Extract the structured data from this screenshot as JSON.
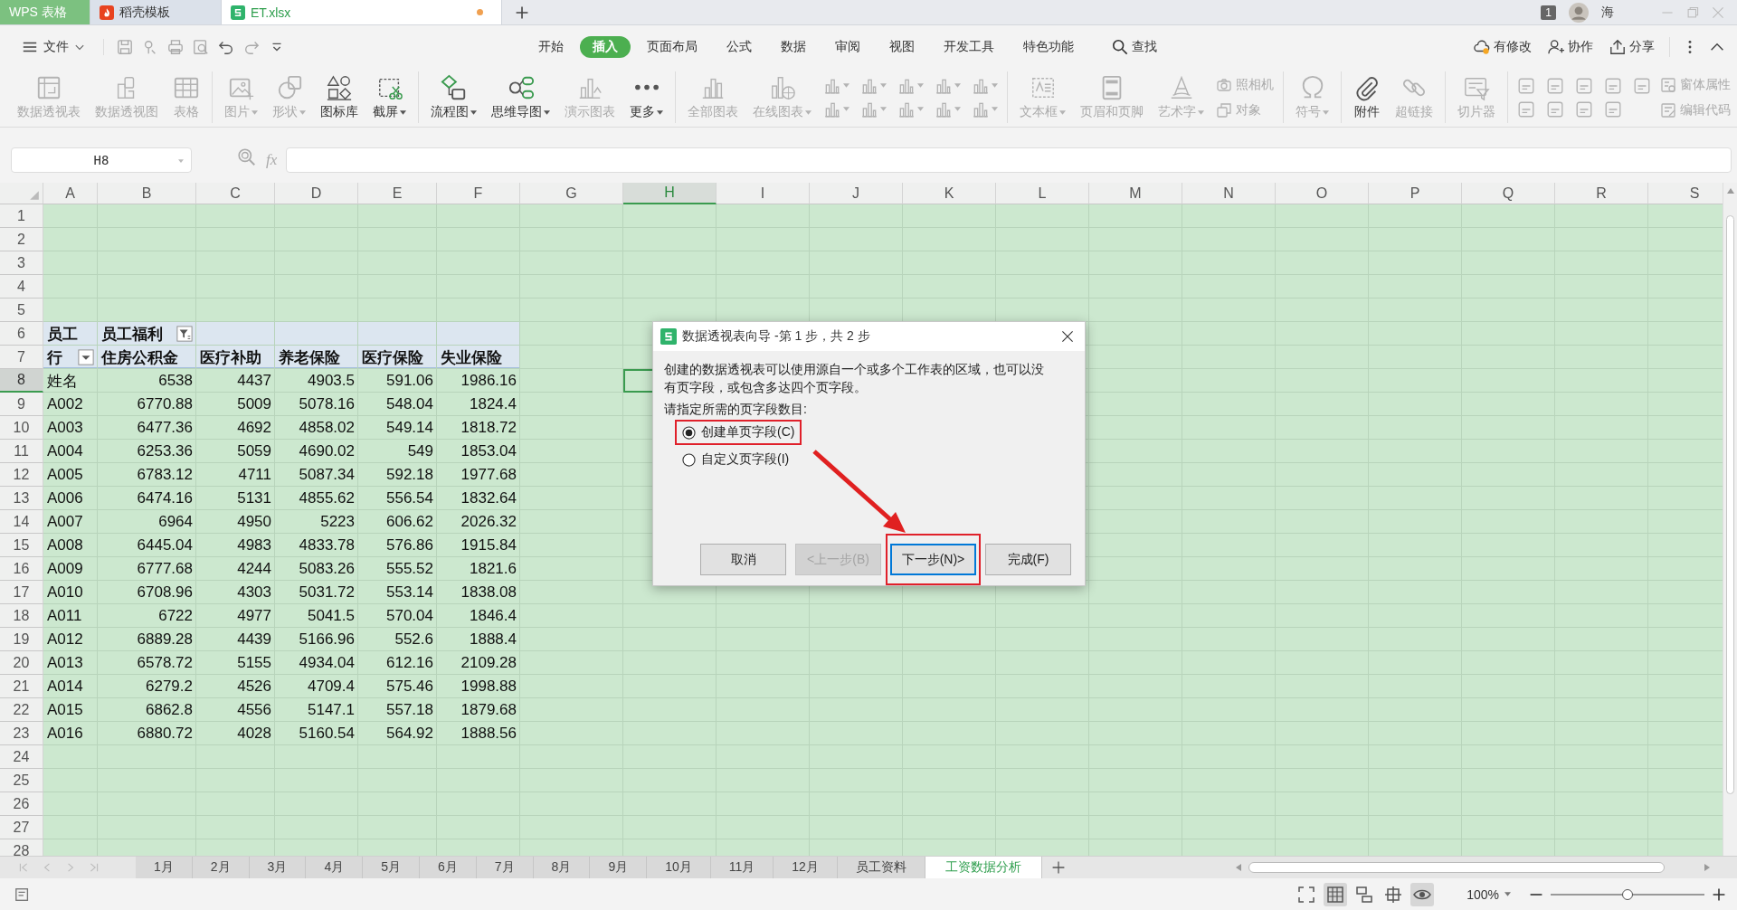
{
  "title_bar": {
    "tabs": [
      {
        "kind": "app",
        "label": "WPS 表格",
        "selected": false,
        "modified": false
      },
      {
        "kind": "template",
        "label": "稻壳模板",
        "selected": false,
        "modified": false
      },
      {
        "kind": "document",
        "label": "ET.xlsx",
        "selected": true,
        "modified": true
      }
    ],
    "badge": "1",
    "user": "海"
  },
  "menu_bar": {
    "file": "文件",
    "tabs": [
      {
        "label": "开始",
        "selected": false
      },
      {
        "label": "插入",
        "selected": true
      },
      {
        "label": "页面布局",
        "selected": false
      },
      {
        "label": "公式",
        "selected": false
      },
      {
        "label": "数据",
        "selected": false
      },
      {
        "label": "审阅",
        "selected": false
      },
      {
        "label": "视图",
        "selected": false
      },
      {
        "label": "开发工具",
        "selected": false
      },
      {
        "label": "特色功能",
        "selected": false
      }
    ],
    "search": "查找",
    "actions": [
      "有修改",
      "协作",
      "分享"
    ]
  },
  "ribbon": [
    {
      "items": [
        {
          "kind": "large",
          "label": "数据透视表",
          "disabled": true,
          "dropdown": false
        },
        {
          "kind": "large",
          "label": "数据透视图",
          "disabled": true,
          "dropdown": false
        },
        {
          "kind": "large",
          "label": "表格",
          "disabled": true,
          "dropdown": false
        }
      ]
    },
    {
      "items": [
        {
          "kind": "large",
          "label": "图片",
          "disabled": true,
          "dropdown": true
        },
        {
          "kind": "large",
          "label": "形状",
          "disabled": true,
          "dropdown": true
        },
        {
          "kind": "large",
          "label": "图标库",
          "disabled": false,
          "dropdown": false
        },
        {
          "kind": "large",
          "label": "截屏",
          "disabled": false,
          "dropdown": true
        }
      ]
    },
    {
      "items": [
        {
          "kind": "large",
          "label": "流程图",
          "disabled": false,
          "dropdown": true
        },
        {
          "kind": "large",
          "label": "思维导图",
          "disabled": false,
          "dropdown": true
        },
        {
          "kind": "large",
          "label": "演示图表",
          "disabled": true,
          "dropdown": false
        },
        {
          "kind": "large",
          "label": "更多",
          "disabled": false,
          "dropdown": true
        }
      ]
    },
    {
      "items": [
        {
          "kind": "large",
          "label": "全部图表",
          "disabled": true,
          "dropdown": false
        },
        {
          "kind": "large",
          "label": "在线图表",
          "disabled": true,
          "dropdown": true
        },
        {
          "kind": "icon",
          "disabled": true,
          "dropdown": true
        },
        {
          "kind": "icon",
          "disabled": true,
          "dropdown": true
        },
        {
          "kind": "icon",
          "disabled": true,
          "dropdown": true
        },
        {
          "kind": "icon",
          "disabled": true,
          "dropdown": true
        },
        {
          "kind": "icon",
          "disabled": true,
          "dropdown": true
        },
        {
          "kind": "icon",
          "disabled": true,
          "dropdown": true
        },
        {
          "kind": "icon",
          "disabled": true,
          "dropdown": true
        },
        {
          "kind": "icon",
          "disabled": true,
          "dropdown": true
        },
        {
          "kind": "icon",
          "disabled": true,
          "dropdown": true
        },
        {
          "kind": "icon",
          "disabled": true,
          "dropdown": true
        }
      ]
    },
    {
      "items": [
        {
          "kind": "large",
          "label": "文本框",
          "disabled": true,
          "dropdown": true
        },
        {
          "kind": "large",
          "label": "页眉和页脚",
          "disabled": true,
          "dropdown": false
        },
        {
          "kind": "large",
          "label": "艺术字",
          "disabled": true,
          "dropdown": true
        },
        {
          "kind": "small",
          "label": "照相机",
          "disabled": true,
          "dropdown": false
        },
        {
          "kind": "small",
          "label": "对象",
          "disabled": true,
          "dropdown": false
        }
      ]
    },
    {
      "items": [
        {
          "kind": "large",
          "label": "符号",
          "disabled": true,
          "dropdown": true
        }
      ]
    },
    {
      "items": [
        {
          "kind": "large",
          "label": "附件",
          "disabled": false,
          "dropdown": false
        },
        {
          "kind": "large",
          "label": "超链接",
          "disabled": true,
          "dropdown": false
        }
      ]
    },
    {
      "items": [
        {
          "kind": "large",
          "label": "切片器",
          "disabled": true,
          "dropdown": false
        }
      ]
    },
    {
      "items": [
        {
          "kind": "icon",
          "disabled": true,
          "dropdown": false
        },
        {
          "kind": "icon",
          "disabled": true,
          "dropdown": false
        },
        {
          "kind": "icon",
          "disabled": true,
          "dropdown": false
        },
        {
          "kind": "icon",
          "disabled": true,
          "dropdown": false
        },
        {
          "kind": "icon",
          "disabled": true,
          "dropdown": false
        },
        {
          "kind": "icon",
          "disabled": true,
          "dropdown": false
        },
        {
          "kind": "icon",
          "disabled": true,
          "dropdown": false
        },
        {
          "kind": "icon",
          "disabled": true,
          "dropdown": false
        },
        {
          "kind": "icon",
          "disabled": true,
          "dropdown": false
        },
        {
          "kind": "small",
          "label": "窗体属性",
          "disabled": true,
          "dropdown": false
        },
        {
          "kind": "small",
          "label": "编辑代码",
          "disabled": true,
          "dropdown": false
        }
      ]
    }
  ],
  "formula_bar": {
    "name_box": "H8",
    "function_label": "fx"
  },
  "sheet": {
    "columns": [
      {
        "label": "A",
        "selected": false
      },
      {
        "label": "B",
        "selected": false
      },
      {
        "label": "C",
        "selected": false
      },
      {
        "label": "D",
        "selected": false
      },
      {
        "label": "E",
        "selected": false
      },
      {
        "label": "F",
        "selected": false
      },
      {
        "label": "G",
        "selected": false
      },
      {
        "label": "H",
        "selected": true
      },
      {
        "label": "I",
        "selected": false
      },
      {
        "label": "J",
        "selected": false
      },
      {
        "label": "K",
        "selected": false
      },
      {
        "label": "L",
        "selected": false
      },
      {
        "label": "M",
        "selected": false
      },
      {
        "label": "N",
        "selected": false
      },
      {
        "label": "O",
        "selected": false
      },
      {
        "label": "P",
        "selected": false
      },
      {
        "label": "Q",
        "selected": false
      },
      {
        "label": "R",
        "selected": false
      },
      {
        "label": "S",
        "selected": false
      }
    ],
    "rows": [
      {
        "label": "1",
        "selected": false
      },
      {
        "label": "2",
        "selected": false
      },
      {
        "label": "3",
        "selected": false
      },
      {
        "label": "4",
        "selected": false
      },
      {
        "label": "5",
        "selected": false
      },
      {
        "label": "6",
        "selected": false
      },
      {
        "label": "7",
        "selected": false
      },
      {
        "label": "8",
        "selected": true
      },
      {
        "label": "9",
        "selected": false
      },
      {
        "label": "10",
        "selected": false
      },
      {
        "label": "11",
        "selected": false
      },
      {
        "label": "12",
        "selected": false
      },
      {
        "label": "13",
        "selected": false
      },
      {
        "label": "14",
        "selected": false
      },
      {
        "label": "15",
        "selected": false
      },
      {
        "label": "16",
        "selected": false
      },
      {
        "label": "17",
        "selected": false
      },
      {
        "label": "18",
        "selected": false
      },
      {
        "label": "19",
        "selected": false
      },
      {
        "label": "20",
        "selected": false
      },
      {
        "label": "21",
        "selected": false
      },
      {
        "label": "22",
        "selected": false
      },
      {
        "label": "23",
        "selected": false
      },
      {
        "label": "24",
        "selected": false
      },
      {
        "label": "25",
        "selected": false
      },
      {
        "label": "26",
        "selected": false
      },
      {
        "label": "27",
        "selected": false
      },
      {
        "label": "28",
        "selected": false
      }
    ],
    "pivot": {
      "page_field": "员工",
      "page_value": "员工福利",
      "row_field": "行",
      "headers": [
        "住房公积金",
        "医疗补助",
        "养老保险",
        "医疗保险",
        "失业保险"
      ],
      "rows": [
        [
          "姓名",
          "6538",
          "4437",
          "4903.5",
          "591.06",
          "1986.16"
        ],
        [
          "A002",
          "6770.88",
          "5009",
          "5078.16",
          "548.04",
          "1824.4"
        ],
        [
          "A003",
          "6477.36",
          "4692",
          "4858.02",
          "549.14",
          "1818.72"
        ],
        [
          "A004",
          "6253.36",
          "5059",
          "4690.02",
          "549",
          "1853.04"
        ],
        [
          "A005",
          "6783.12",
          "4711",
          "5087.34",
          "592.18",
          "1977.68"
        ],
        [
          "A006",
          "6474.16",
          "5131",
          "4855.62",
          "556.54",
          "1832.64"
        ],
        [
          "A007",
          "6964",
          "4950",
          "5223",
          "606.62",
          "2026.32"
        ],
        [
          "A008",
          "6445.04",
          "4983",
          "4833.78",
          "576.86",
          "1915.84"
        ],
        [
          "A009",
          "6777.68",
          "4244",
          "5083.26",
          "555.52",
          "1821.6"
        ],
        [
          "A010",
          "6708.96",
          "4303",
          "5031.72",
          "553.14",
          "1838.08"
        ],
        [
          "A011",
          "6722",
          "4977",
          "5041.5",
          "570.04",
          "1846.4"
        ],
        [
          "A012",
          "6889.28",
          "4439",
          "5166.96",
          "552.6",
          "1888.4"
        ],
        [
          "A013",
          "6578.72",
          "5155",
          "4934.04",
          "612.16",
          "2109.28"
        ],
        [
          "A014",
          "6279.2",
          "4526",
          "4709.4",
          "575.46",
          "1998.88"
        ],
        [
          "A015",
          "6862.8",
          "4556",
          "5147.1",
          "557.18",
          "1879.68"
        ],
        [
          "A016",
          "6880.72",
          "4028",
          "5160.54",
          "564.92",
          "1888.56"
        ]
      ]
    }
  },
  "dialog": {
    "title": "数据透视表向导 -第 1 步，共 2 步",
    "description": "创建的数据透视表可以使用源自一个或多个工作表的区域，也可以没有页字段，或包含多达四个页字段。",
    "prompt": "请指定所需的页字段数目:",
    "options": [
      {
        "label": "创建单页字段(C)",
        "selected": true,
        "highlighted": true
      },
      {
        "label": "自定义页字段(I)",
        "selected": false,
        "highlighted": false
      }
    ],
    "buttons": [
      {
        "label": "取消",
        "disabled": false,
        "focused": false,
        "highlighted": false
      },
      {
        "label": "<上一步(B)",
        "disabled": true,
        "focused": false,
        "highlighted": false
      },
      {
        "label": "下一步(N)>",
        "disabled": false,
        "focused": true,
        "highlighted": true
      },
      {
        "label": "完成(F)",
        "disabled": false,
        "focused": false,
        "highlighted": false
      }
    ]
  },
  "sheet_tabs": [
    {
      "label": "1月",
      "selected": false
    },
    {
      "label": "2月",
      "selected": false
    },
    {
      "label": "3月",
      "selected": false
    },
    {
      "label": "4月",
      "selected": false
    },
    {
      "label": "5月",
      "selected": false
    },
    {
      "label": "6月",
      "selected": false
    },
    {
      "label": "7月",
      "selected": false
    },
    {
      "label": "8月",
      "selected": false
    },
    {
      "label": "9月",
      "selected": false
    },
    {
      "label": "10月",
      "selected": false
    },
    {
      "label": "11月",
      "selected": false
    },
    {
      "label": "12月",
      "selected": false
    },
    {
      "label": "员工资料",
      "selected": false
    },
    {
      "label": "工资数据分析",
      "selected": true
    }
  ],
  "status_bar": {
    "view_modes": [
      {
        "selected": false
      },
      {
        "selected": true
      },
      {
        "selected": false
      },
      {
        "selected": false
      },
      {
        "selected": true
      }
    ],
    "zoom": "100%",
    "zoom_slider": {
      "level": 0.5
    }
  }
}
